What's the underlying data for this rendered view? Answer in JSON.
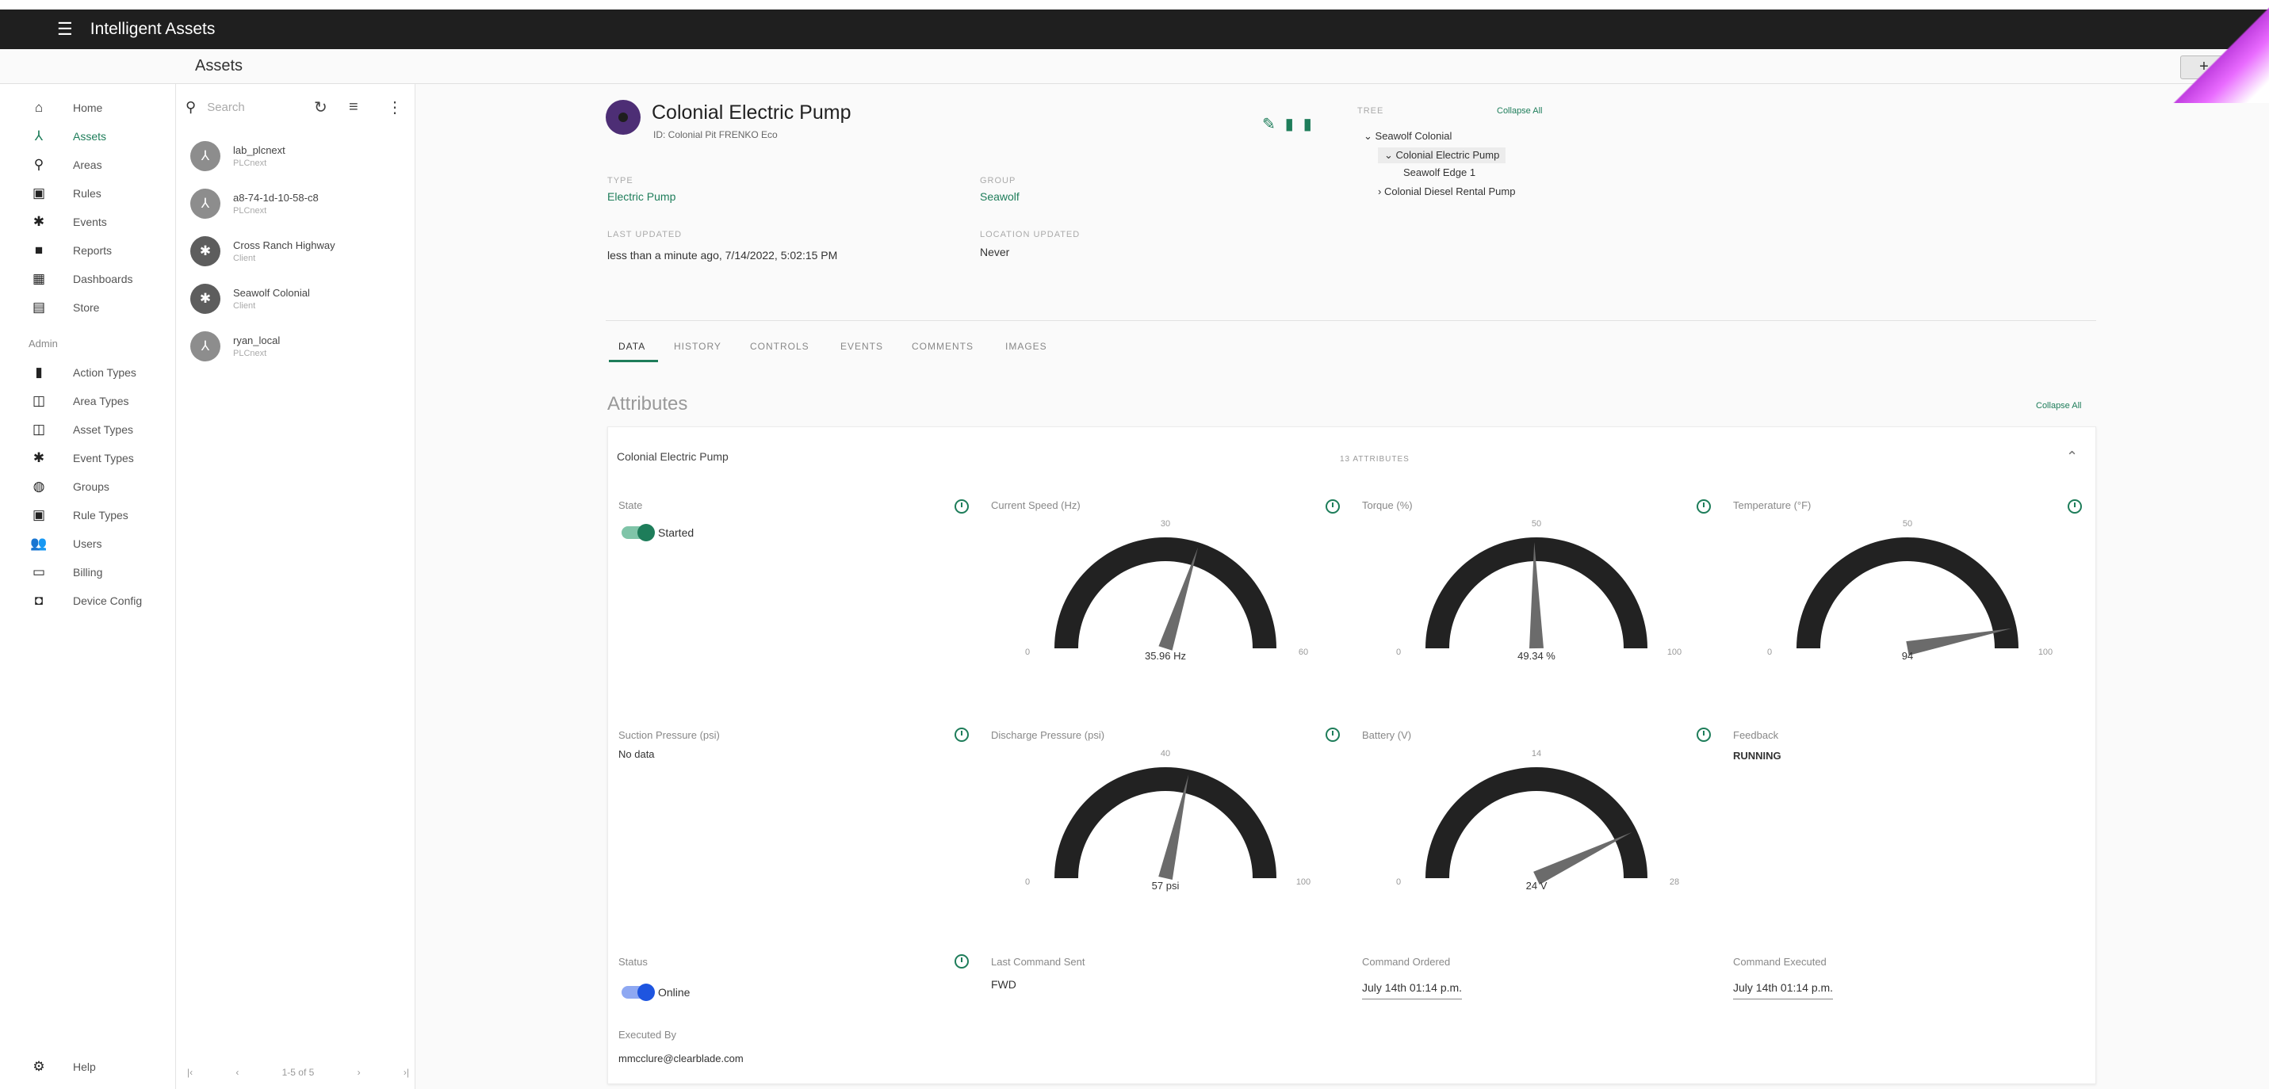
{
  "app": {
    "title": "Intelligent Assets",
    "page_title": "Assets",
    "add_label": "+"
  },
  "nav": {
    "items": [
      {
        "label": "Home",
        "icon": "home-icon",
        "glyph": "⌂"
      },
      {
        "label": "Assets",
        "icon": "assets-icon",
        "glyph": "⅄",
        "active": true
      },
      {
        "label": "Areas",
        "icon": "pin-icon",
        "glyph": "⚲"
      },
      {
        "label": "Rules",
        "icon": "rules-icon",
        "glyph": "▣"
      },
      {
        "label": "Events",
        "icon": "events-icon",
        "glyph": "✱"
      },
      {
        "label": "Reports",
        "icon": "reports-icon",
        "glyph": "■"
      },
      {
        "label": "Dashboards",
        "icon": "dashboards-icon",
        "glyph": "▦"
      },
      {
        "label": "Store",
        "icon": "store-icon",
        "glyph": "▤"
      }
    ],
    "admin_label": "Admin",
    "admin_items": [
      {
        "label": "Action Types",
        "icon": "action-types-icon",
        "glyph": "▮"
      },
      {
        "label": "Area Types",
        "icon": "area-types-icon",
        "glyph": "◫"
      },
      {
        "label": "Asset Types",
        "icon": "asset-types-icon",
        "glyph": "◫"
      },
      {
        "label": "Event Types",
        "icon": "event-types-icon",
        "glyph": "✱"
      },
      {
        "label": "Groups",
        "icon": "groups-icon",
        "glyph": "◍"
      },
      {
        "label": "Rule Types",
        "icon": "rule-types-icon",
        "glyph": "▣"
      },
      {
        "label": "Users",
        "icon": "users-icon",
        "glyph": "👥"
      },
      {
        "label": "Billing",
        "icon": "billing-icon",
        "glyph": "▭"
      },
      {
        "label": "Device Config",
        "icon": "device-config-icon",
        "glyph": "◘"
      }
    ],
    "help_label": "Help"
  },
  "list": {
    "search_placeholder": "Search",
    "assets": [
      {
        "name": "lab_plcnext",
        "type": "PLCnext",
        "dark": false
      },
      {
        "name": "a8-74-1d-10-58-c8",
        "type": "PLCnext",
        "dark": false
      },
      {
        "name": "Cross Ranch Highway",
        "type": "Client",
        "dark": true
      },
      {
        "name": "Seawolf Colonial",
        "type": "Client",
        "dark": true
      },
      {
        "name": "ryan_local",
        "type": "PLCnext",
        "dark": false
      }
    ],
    "pager": {
      "first": "|‹",
      "prev": "‹",
      "range": "1-5 of 5",
      "next": "›",
      "last": "›|"
    }
  },
  "asset": {
    "name": "Colonial Electric Pump",
    "id_line": "ID: Colonial Pit FRENKO Eco",
    "type_label": "TYPE",
    "type_value": "Electric Pump",
    "group_label": "GROUP",
    "group_value": "Seawolf",
    "last_updated_label": "LAST UPDATED",
    "last_updated_value": "less than a minute ago,  7/14/2022, 5:02:15 PM",
    "location_updated_label": "LOCATION UPDATED",
    "location_updated_value": "Never"
  },
  "tree": {
    "label": "TREE",
    "collapse_label": "Collapse All",
    "nodes": [
      {
        "label": "Seawolf Colonial",
        "prefix": "⌄"
      },
      {
        "label": "Colonial Electric Pump",
        "prefix": "⌄",
        "selected": true
      },
      {
        "label": "Seawolf Edge 1",
        "prefix": ""
      },
      {
        "label": "Colonial Diesel Rental Pump",
        "prefix": "›"
      }
    ]
  },
  "tabs": [
    "DATA",
    "HISTORY",
    "CONTROLS",
    "EVENTS",
    "COMMENTS",
    "IMAGES"
  ],
  "attributes": {
    "title": "Attributes",
    "collapse_label": "Collapse All",
    "card_name": "Colonial Electric Pump",
    "card_count": "13 ATTRIBUTES",
    "state": {
      "label": "State",
      "value": "Started"
    },
    "suction": {
      "label": "Suction Pressure (psi)",
      "value": "No data"
    },
    "status": {
      "label": "Status",
      "value": "Online"
    },
    "last_command": {
      "label": "Last Command Sent",
      "value": "FWD"
    },
    "command_ordered": {
      "label": "Command Ordered",
      "value": "July 14th 01:14 p.m."
    },
    "command_executed": {
      "label": "Command Executed",
      "value": "July 14th 01:14 p.m."
    },
    "executed_by": {
      "label": "Executed By",
      "value": "mmcclure@clearblade.com"
    },
    "feedback": {
      "label": "Feedback",
      "value": "RUNNING"
    }
  },
  "gauges": [
    {
      "label": "Current Speed (Hz)",
      "min": 0,
      "max": 60,
      "mid": "30",
      "value": 35.96,
      "value_text": "35.96 Hz",
      "min_text": "0",
      "max_text": "60"
    },
    {
      "label": "Torque (%)",
      "min": 0,
      "max": 100,
      "mid": "50",
      "value": 49.34,
      "value_text": "49.34 %",
      "min_text": "0",
      "max_text": "100"
    },
    {
      "label": "Temperature (°F)",
      "min": 0,
      "max": 100,
      "mid": "50",
      "value": 94,
      "value_text": "94",
      "min_text": "0",
      "max_text": "100"
    },
    {
      "label": "Discharge Pressure (psi)",
      "min": 0,
      "max": 100,
      "mid": "40",
      "value": 57,
      "value_text": "57 psi",
      "min_text": "0",
      "max_text": "100"
    },
    {
      "label": "Battery (V)",
      "min": 0,
      "max": 28,
      "mid": "14",
      "value": 24,
      "value_text": "24 V",
      "min_text": "0",
      "max_text": "28"
    }
  ],
  "colors": {
    "accent": "#1e7d5a",
    "toggle_blue": "#1e55e0",
    "topbar": "#1f1f1f",
    "gauge_arc": "#222222",
    "needle": "#6b6b6b"
  }
}
